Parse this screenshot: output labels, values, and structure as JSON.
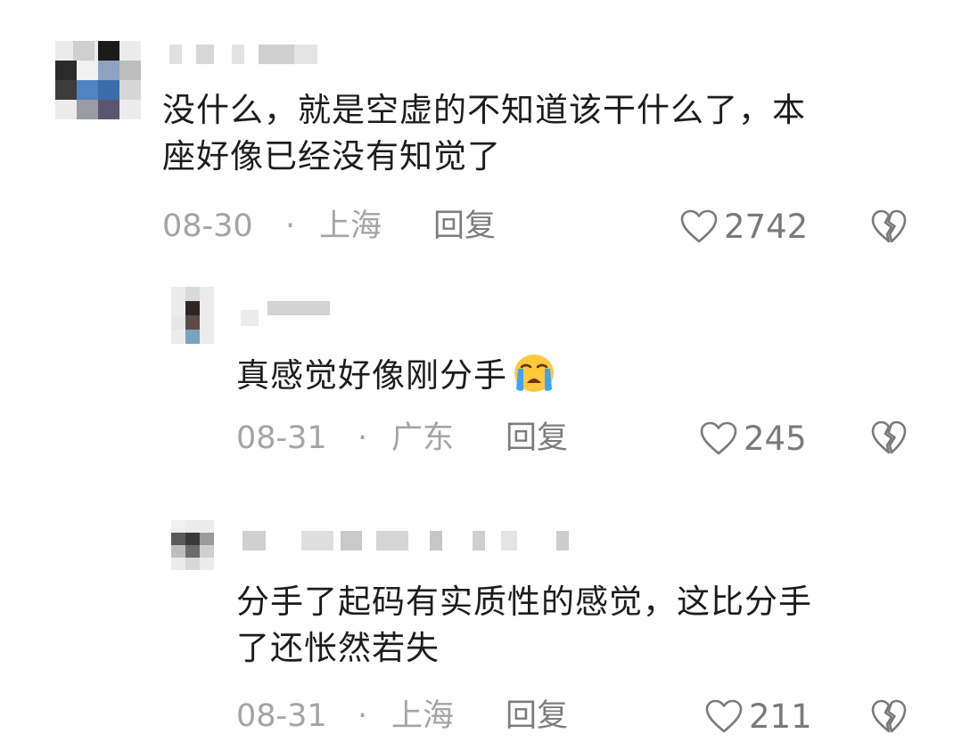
{
  "comments": [
    {
      "text_line1": "没什么，就是空虚的不知道该干什么了，本",
      "text_line2": "座好像已经没有知觉了",
      "date": "08-30",
      "separator": "·",
      "location": "上海",
      "reply_label": "回复",
      "like_count": "2742"
    },
    {
      "text_line1": "真感觉好像刚分手",
      "emoji": "loudly-crying-face-emoji",
      "date": "08-31",
      "separator": "·",
      "location": "广东",
      "reply_label": "回复",
      "like_count": "245"
    },
    {
      "text_line1": "分手了起码有实质性的感觉，这比分手",
      "text_line2": "了还怅然若失",
      "date": "08-31",
      "separator": "·",
      "location": "上海",
      "reply_label": "回复",
      "like_count": "211"
    }
  ],
  "icons": {
    "like": "heart-outline-icon",
    "dislike": "broken-heart-icon"
  },
  "colors": {
    "text": "#1c1c1c",
    "meta": "#a4a4a4",
    "reply": "#7d7d7d",
    "icon": "#7a7a7a"
  }
}
